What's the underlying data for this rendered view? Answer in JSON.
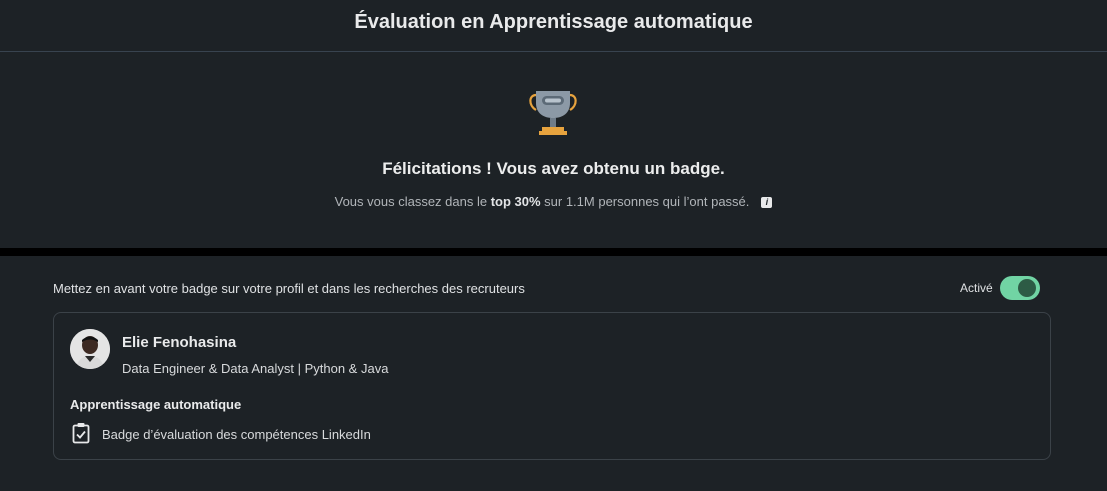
{
  "header": {
    "title": "Évaluation en Apprentissage automatique"
  },
  "hero": {
    "icon": "trophy-icon",
    "congrats": "Félicitations ! Vous avez obtenu un badge.",
    "rank_prefix": "Vous vous classez dans le ",
    "rank_highlight": "top 30%",
    "rank_suffix": " sur 1.1M personnes qui l’ont passé.",
    "info_icon_glyph": "i"
  },
  "promote": {
    "text": "Mettez en avant votre badge sur votre profil et dans les recherches des recruteurs",
    "toggle_label": "Activé",
    "toggle_on": true,
    "toggle_color": "#71d4a4"
  },
  "card": {
    "name": "Elie Fenohasina",
    "headline": "Data Engineer & Data Analyst | Python & Java",
    "skill": "Apprentissage automatique",
    "badge_icon": "clipboard-check-icon",
    "badge_text": "Badge d’évaluation des compétences LinkedIn"
  }
}
